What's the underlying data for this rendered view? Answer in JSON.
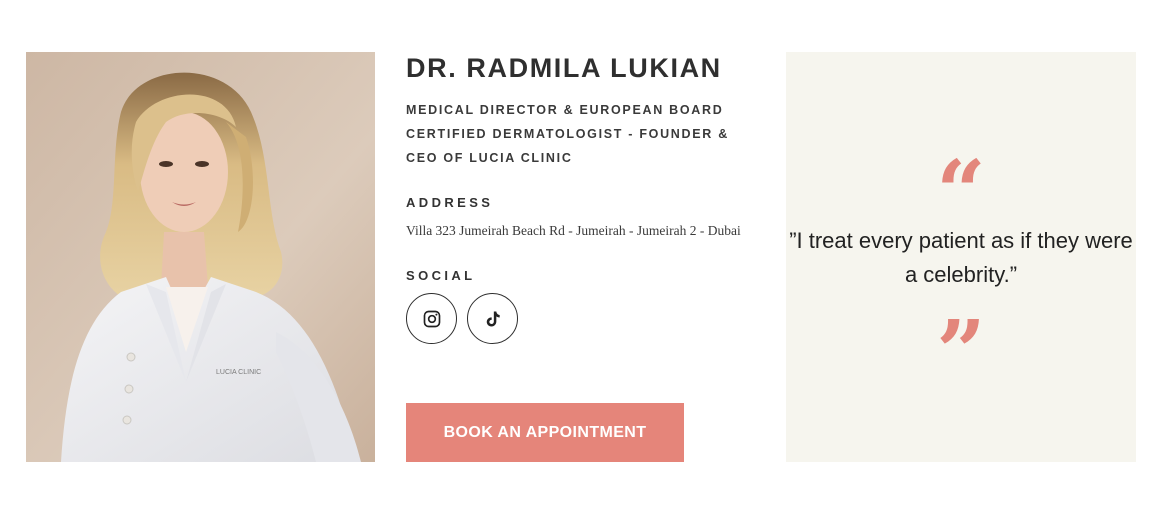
{
  "doctor": {
    "name": "DR. RADMILA LUKIAN",
    "title": "MEDICAL DIRECTOR & EUROPEAN BOARD CERTIFIED DERMATOLOGIST - FOUNDER & CEO OF LUCIA CLINIC"
  },
  "address": {
    "label": "ADDRESS",
    "value": "Villa 323 Jumeirah Beach Rd - Jumeirah - Jumeirah 2 - Dubai"
  },
  "social": {
    "label": "SOCIAL",
    "icons": [
      "instagram-icon",
      "tiktok-icon"
    ]
  },
  "cta": {
    "book_label": "BOOK AN APPOINTMENT"
  },
  "quote": {
    "open_mark": "“",
    "text": "”I treat every patient as if they were a celebrity.”",
    "close_mark": "”"
  },
  "photo": {
    "coat_logo": "LUCIA CLINIC"
  },
  "colors": {
    "accent": "#e5857a",
    "quote_bg": "#f6f5ee",
    "photo_bg": "#d9c5b3"
  }
}
